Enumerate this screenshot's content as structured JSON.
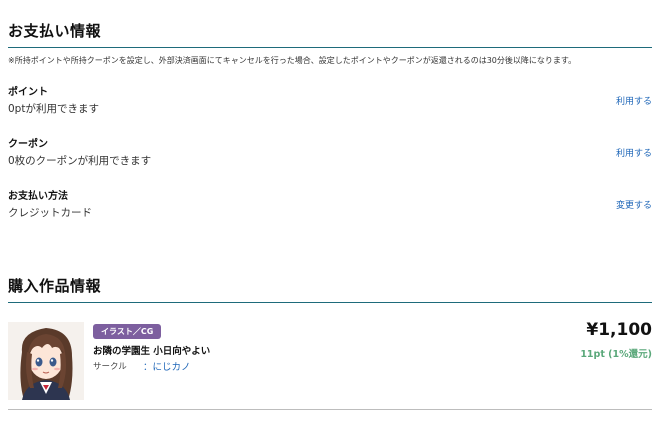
{
  "payment": {
    "title": "お支払い情報",
    "notice": "※所持ポイントや所持クーポンを設定し、外部決済画面にてキャンセルを行った場合、設定したポイントやクーポンが返還されるのは30分後以降になります。",
    "points": {
      "label": "ポイント",
      "value": "0ptが利用できます",
      "action": "利用する"
    },
    "coupon": {
      "label": "クーポン",
      "value": "0枚のクーポンが利用できます",
      "action": "利用する"
    },
    "method": {
      "label": "お支払い方法",
      "value": "クレジットカード",
      "action": "変更する"
    }
  },
  "purchase": {
    "title": "購入作品情報",
    "item": {
      "category": "イラスト／CG",
      "name": "お隣の学園生 小日向やよい",
      "circle_label": "サークル",
      "circle_name": "：にじカノ",
      "price": "¥1,100",
      "points": "11pt (1%還元)"
    }
  },
  "colors": {
    "accent_rule": "#1e6b7b",
    "link": "#1e66b8",
    "badge": "#7d5f9f",
    "points": "#5aa87a"
  },
  "icons": {
    "thumbnail": "anime-girl-thumbnail"
  }
}
